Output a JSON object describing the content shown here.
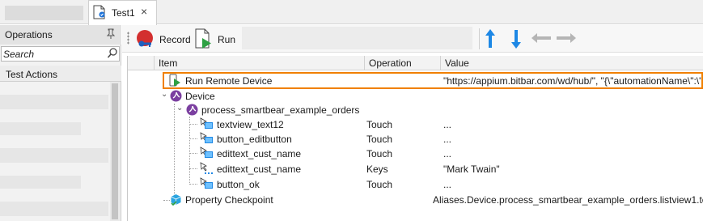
{
  "tabs": [
    {
      "label": "Test1",
      "close": "×"
    }
  ],
  "left_panel": {
    "title": "Operations",
    "search": {
      "placeholder": "Search",
      "value": ""
    },
    "section": "Test Actions"
  },
  "toolbar": {
    "record_label": "Record",
    "run_label": "Run"
  },
  "grid": {
    "columns": [
      "Item",
      "Operation",
      "Value"
    ],
    "rows": [
      {
        "item": "Run Remote Device",
        "operation": "",
        "value": "\"https://appium.bitbar.com/wd/hub/\", \"{\\\"automationName\\\":\\\"U",
        "icon": "run-remote-device-icon"
      },
      {
        "item": "Device",
        "operation": "",
        "value": "",
        "icon": "device-icon"
      },
      {
        "item": "process_smartbear_example_orders",
        "operation": "",
        "value": "",
        "icon": "process-icon"
      },
      {
        "item": "textview_text12",
        "operation": "Touch",
        "value": "...",
        "icon": "onscreen-object-icon"
      },
      {
        "item": "button_editbutton",
        "operation": "Touch",
        "value": "...",
        "icon": "onscreen-object-icon"
      },
      {
        "item": "edittext_cust_name",
        "operation": "Touch",
        "value": "...",
        "icon": "onscreen-object-icon"
      },
      {
        "item": "edittext_cust_name",
        "operation": "Keys",
        "value": "\"Mark Twain\"",
        "icon": "keys-icon"
      },
      {
        "item": "button_ok",
        "operation": "Touch",
        "value": "...",
        "icon": "onscreen-object-icon"
      },
      {
        "item": "Property Checkpoint",
        "operation": "",
        "value": "Aliases.Device.process_smartbear_example_orders.listview1.te",
        "icon": "checkpoint-icon"
      }
    ]
  },
  "colors": {
    "highlight": "#f08000",
    "accent_blue": "#1e88e5",
    "record_red": "#d32f2f",
    "run_green": "#2ea043"
  }
}
